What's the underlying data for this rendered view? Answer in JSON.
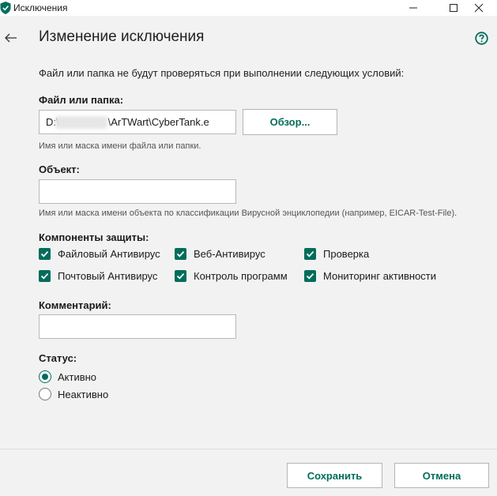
{
  "window": {
    "title": "Исключения",
    "minimize": "—",
    "maximize": "☐",
    "close": "✕"
  },
  "header": {
    "title": "Изменение исключения"
  },
  "intro": "Файл или папка не будут проверяться при выполнении следующих условий:",
  "file": {
    "label": "Файл или папка:",
    "value_start": "D:\\",
    "value_end": "\\ArTWart\\CyberTank.e",
    "hint": "Имя или маска имени файла или папки.",
    "browse_label": "Обзор..."
  },
  "object": {
    "label": "Объект:",
    "value": "",
    "hint": "Имя или маска имени объекта по классификации Вирусной энциклопедии (например, EICAR-Test-File)."
  },
  "components": {
    "label": "Компоненты защиты:",
    "items": [
      {
        "label": "Файловый Антивирус",
        "checked": true
      },
      {
        "label": "Веб-Антивирус",
        "checked": true
      },
      {
        "label": "Проверка",
        "checked": true
      },
      {
        "label": "Почтовый Антивирус",
        "checked": true
      },
      {
        "label": "Контроль программ",
        "checked": true
      },
      {
        "label": "Мониторинг активности",
        "checked": true
      }
    ]
  },
  "comment": {
    "label": "Комментарий:",
    "value": ""
  },
  "status": {
    "label": "Статус:",
    "options": [
      {
        "label": "Активно",
        "selected": true
      },
      {
        "label": "Неактивно",
        "selected": false
      }
    ]
  },
  "footer": {
    "save_label": "Сохранить",
    "cancel_label": "Отмена"
  },
  "colors": {
    "accent": "#006d5b",
    "background": "#f2f2f2"
  }
}
